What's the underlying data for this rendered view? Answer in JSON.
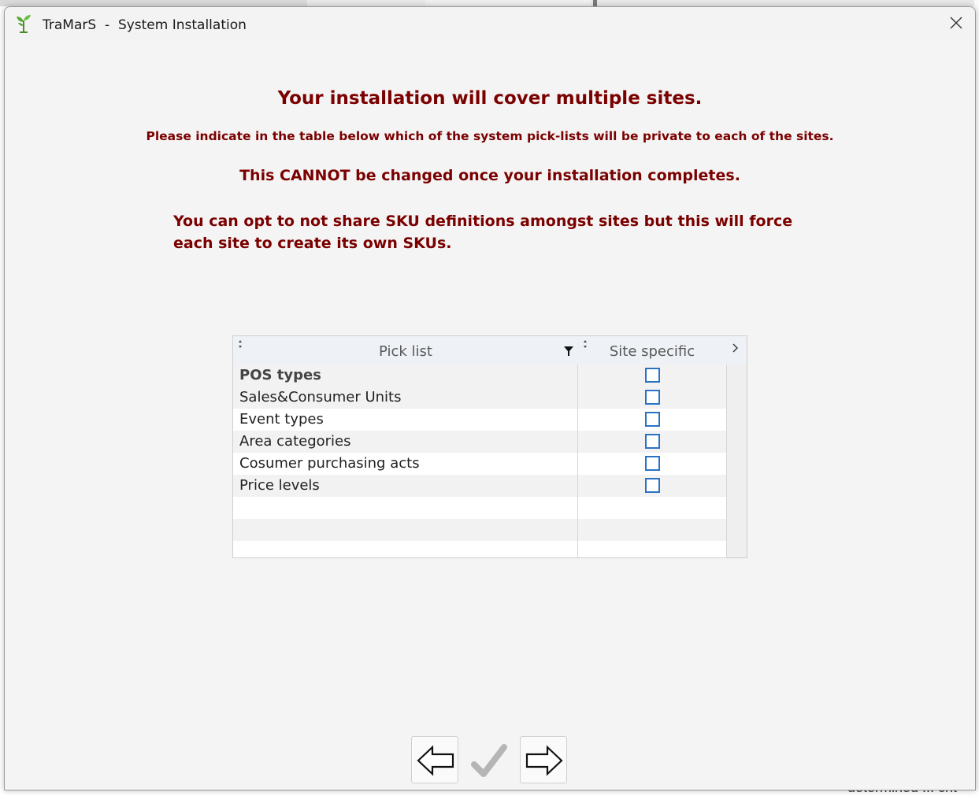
{
  "window": {
    "app_name": "TraMarS",
    "separator": "-",
    "title": "System Installation"
  },
  "messages": {
    "headline": "Your installation will cover multiple sites.",
    "instruction": "Please indicate in the table below which of the system pick-lists will be private to each of the sites.",
    "warning": "This CANNOT be changed once your installation completes.",
    "sku_note": "You can opt to not share SKU definitions amongst sites but this will force each site to create its own SKUs."
  },
  "grid": {
    "columns": {
      "pick_list": "Pick list",
      "site_specific": "Site specific"
    },
    "rows": [
      {
        "label": "POS types",
        "site_specific": false
      },
      {
        "label": "Sales&Consumer Units",
        "site_specific": false
      },
      {
        "label": "Event types",
        "site_specific": false
      },
      {
        "label": "Area categories",
        "site_specific": false
      },
      {
        "label": "Cosumer purchasing acts",
        "site_specific": false
      },
      {
        "label": "Price levels",
        "site_specific": false
      }
    ]
  },
  "background": {
    "bottom_text": "determined ... crit"
  },
  "colors": {
    "message_text": "#7b0000",
    "checkbox_border": "#2a73c4",
    "header_bg": "#eef1f6"
  },
  "icons": {
    "app": "sprout-icon",
    "close": "close-icon",
    "sort": "sort-arrows-icon",
    "filter": "filter-funnel-icon",
    "scroll_right": "chevron-right-icon",
    "back": "arrow-left-icon",
    "finish": "checkmark-icon",
    "next": "arrow-right-icon"
  }
}
